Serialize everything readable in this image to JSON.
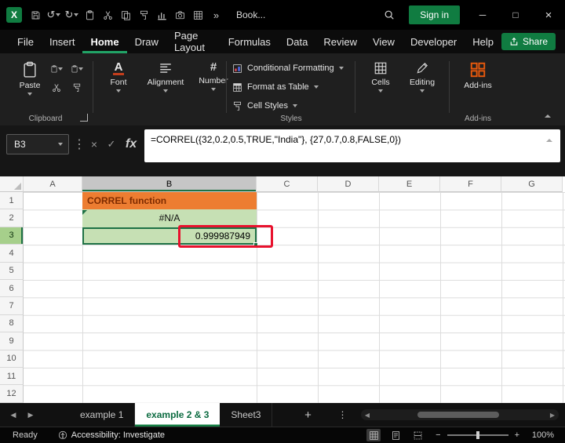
{
  "icons": {
    "excel_logo": "X",
    "undo": "↺",
    "redo": "↻",
    "more": "»",
    "minimize": "─",
    "maximize": "□",
    "close": "×",
    "cancel": "×",
    "enter": "✓",
    "dots": "⋮",
    "prev": "◀",
    "next": "▶",
    "scroll_left": "◀",
    "scroll_right": "▶",
    "new_sheet": "+",
    "all_sheets": "⋮",
    "zoom_out": "−",
    "zoom_in": "+",
    "font_glyph": "A",
    "number_glyph": "#"
  },
  "titlebar": {
    "title": "Book...",
    "signin": "Sign in"
  },
  "menubar": {
    "items": [
      "File",
      "Insert",
      "Home",
      "Draw",
      "Page Layout",
      "Formulas",
      "Data",
      "Review",
      "View",
      "Developer",
      "Help"
    ],
    "share": "Share"
  },
  "ribbon": {
    "paste": "Paste",
    "font": "Font",
    "alignment": "Alignment",
    "number": "Number",
    "conditional_formatting": "Conditional Formatting",
    "format_as_table": "Format as Table",
    "cell_styles": "Cell Styles",
    "cells": "Cells",
    "editing": "Editing",
    "addins": "Add-ins",
    "labels": {
      "clipboard": "Clipboard",
      "styles": "Styles",
      "addins": "Add-ins"
    }
  },
  "formula_bar": {
    "name_box": "B3",
    "fx": "fx",
    "formula": "=CORREL({32,0.2,0.5,TRUE,\"India\"}, {27,0.7,0.8,FALSE,0})"
  },
  "grid": {
    "col_headers": [
      "A",
      "B",
      "C",
      "D",
      "E",
      "F",
      "G"
    ],
    "row_headers": [
      "1",
      "2",
      "3",
      "4",
      "5",
      "6",
      "7",
      "8",
      "9",
      "10",
      "11",
      "12"
    ],
    "b1": "CORREL function",
    "b2": "#N/A",
    "b3": "0.999987949",
    "active_cell": "B3"
  },
  "sheet_bar": {
    "tabs": [
      "example 1",
      "example 2 & 3",
      "Sheet3"
    ]
  },
  "status_bar": {
    "mode": "Ready",
    "accessibility": "Accessibility: Investigate",
    "zoom": "100%"
  },
  "colors": {
    "accent_green": "#107C41",
    "cell_orange_fill": "#ED7D31",
    "cell_green_fill": "#C6E0B4",
    "annotation_red": "#E8112D"
  }
}
